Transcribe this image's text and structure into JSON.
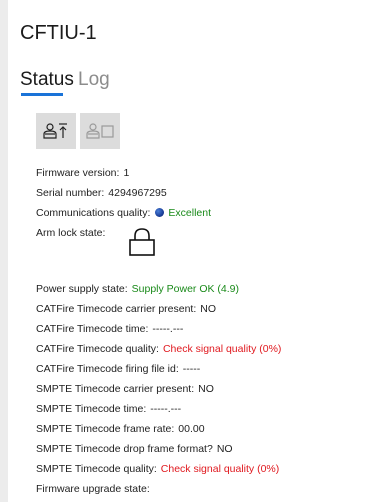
{
  "title": "CFTIU-1",
  "tabs": {
    "status": "Status",
    "log": "Log"
  },
  "toolbar": {
    "button1_icon": "person-up-icon",
    "button2_icon": "person-box-icon"
  },
  "info": {
    "firmware_label": "Firmware version:",
    "firmware_value": "1",
    "serial_label": "Serial number:",
    "serial_value": "4294967295",
    "comm_label": "Communications quality:",
    "comm_value": "Excellent",
    "armlock_label": "Arm lock state:",
    "armlock_icon": "padlock-icon",
    "power_label": "Power supply state:",
    "power_value": "Supply Power OK (4.9)",
    "cat_carrier_label": "CATFire Timecode carrier present:",
    "cat_carrier_value": "NO",
    "cat_time_label": "CATFire Timecode time:",
    "cat_time_value": "-----.---",
    "cat_quality_label": "CATFire Timecode quality:",
    "cat_quality_value": "Check signal quality (0%)",
    "cat_file_label": "CATFire Timecode firing file id:",
    "cat_file_value": "-----",
    "smpte_carrier_label": "SMPTE Timecode carrier present:",
    "smpte_carrier_value": "NO",
    "smpte_time_label": "SMPTE Timecode time:",
    "smpte_time_value": "-----.---",
    "smpte_rate_label": "SMPTE Timecode frame rate:",
    "smpte_rate_value": "00.00",
    "smpte_drop_label": "SMPTE Timecode drop frame format?",
    "smpte_drop_value": "NO",
    "smpte_quality_label": "SMPTE Timecode quality:",
    "smpte_quality_value": "Check signal quality (0%)",
    "fw_upgrade_label": "Firmware upgrade state:"
  },
  "colors": {
    "ok": "#1a8a1a",
    "bad": "#e0191f",
    "accent": "#1a73d8",
    "button_bg": "#dcdcdc"
  }
}
